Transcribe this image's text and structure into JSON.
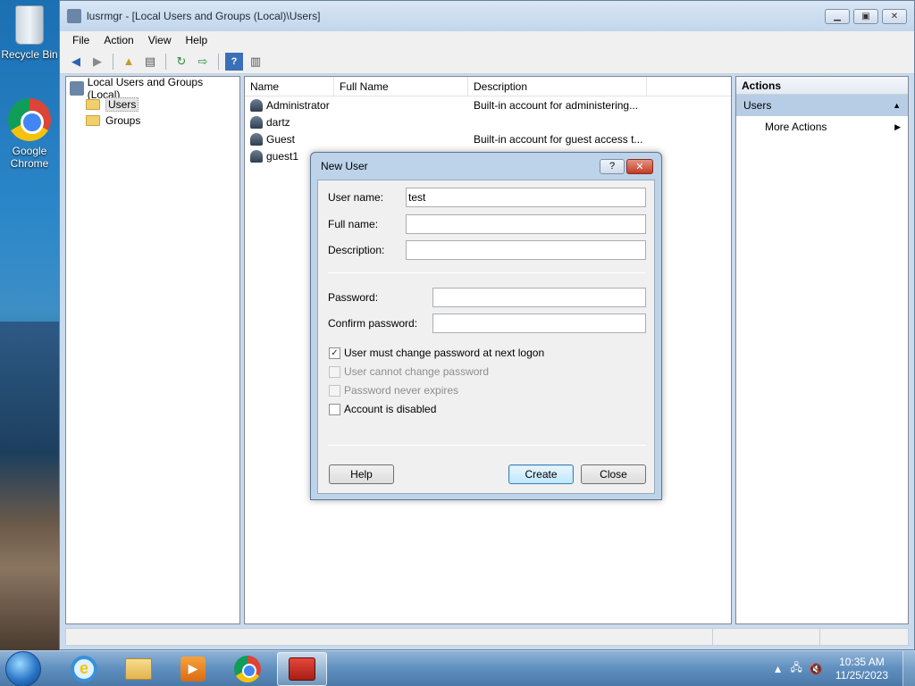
{
  "desktop": {
    "icons": [
      {
        "label": "Recycle Bin",
        "icon": "recycle-bin-icon"
      },
      {
        "label": "Google Chrome",
        "icon": "chrome-icon"
      }
    ]
  },
  "window": {
    "title": "lusrmgr - [Local Users and Groups (Local)\\Users]",
    "controls": {
      "minimize": "▁",
      "maximize": "▣",
      "close": "✕"
    },
    "menu": [
      "File",
      "Action",
      "View",
      "Help"
    ],
    "toolbar": [
      "back-arrow-icon",
      "forward-arrow-icon",
      "up-folder-icon",
      "show-hide-tree-icon",
      "refresh-icon",
      "export-list-icon",
      "help-icon",
      "show-hide-action-pane-icon"
    ]
  },
  "tree": {
    "root": "Local Users and Groups (Local)",
    "children": [
      "Users",
      "Groups"
    ],
    "selected": "Users"
  },
  "list": {
    "columns": [
      "Name",
      "Full Name",
      "Description"
    ],
    "rows": [
      {
        "name": "Administrator",
        "full_name": "",
        "description": "Built-in account for administering..."
      },
      {
        "name": "dartz",
        "full_name": "",
        "description": ""
      },
      {
        "name": "Guest",
        "full_name": "",
        "description": "Built-in account for guest access t..."
      },
      {
        "name": "guest1",
        "full_name": "",
        "description": ""
      }
    ]
  },
  "actions": {
    "header": "Actions",
    "section": "Users",
    "items": [
      "More Actions"
    ]
  },
  "dialog": {
    "title": "New User",
    "help_glyph": "?",
    "close_glyph": "✕",
    "user_name_label": "User name:",
    "user_name_value": "test",
    "full_name_label": "Full name:",
    "full_name_value": "",
    "description_label": "Description:",
    "description_value": "",
    "password_label": "Password:",
    "password_value": "",
    "confirm_label": "Confirm password:",
    "confirm_value": "",
    "checkboxes": [
      {
        "label": "User must change password at next logon",
        "checked": true,
        "enabled": true
      },
      {
        "label": "User cannot change password",
        "checked": false,
        "enabled": false
      },
      {
        "label": "Password never expires",
        "checked": false,
        "enabled": false
      },
      {
        "label": "Account is disabled",
        "checked": false,
        "enabled": true
      }
    ],
    "buttons": {
      "help": "Help",
      "create": "Create",
      "close": "Close"
    }
  },
  "taskbar": {
    "apps": [
      "internet-explorer-icon",
      "file-explorer-icon",
      "media-player-icon",
      "chrome-icon",
      "computer-management-icon"
    ],
    "active_app": "computer-management-icon",
    "clock_time": "10:35 AM",
    "clock_date": "11/25/2023",
    "tray_icons": [
      "show-hidden-icons-arrow",
      "network-icon",
      "volume-muted-icon"
    ]
  }
}
